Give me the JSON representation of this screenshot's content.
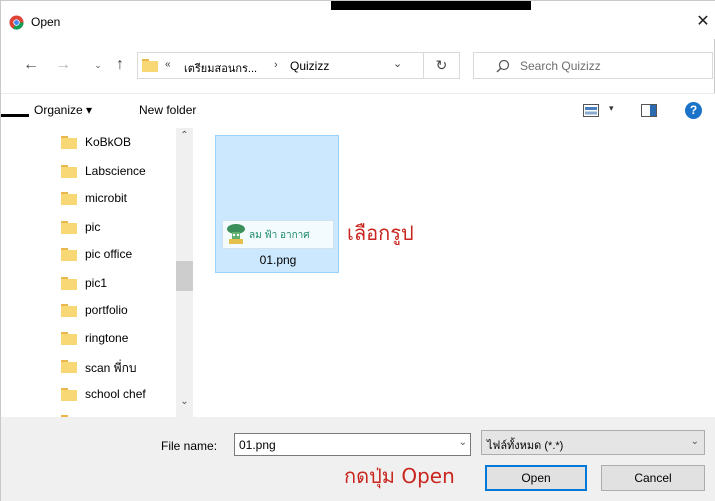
{
  "window": {
    "title": "Open",
    "close_glyph": "✕"
  },
  "nav": {
    "back_glyph": "←",
    "forward_glyph": "→",
    "recent_glyph": "⌄",
    "up_glyph": "↑",
    "address": {
      "chevron": "«",
      "segment1": "เตรียมสอนกร...",
      "separator": "›",
      "segment2": "Quizizz",
      "dropdown_glyph": "⌄"
    },
    "refresh_glyph": "↻",
    "search_placeholder": "Search Quizizz"
  },
  "toolbar": {
    "organize_label": "Organize ▾",
    "new_folder_label": "New folder",
    "view_dropdown_glyph": "▾",
    "help_glyph": "?"
  },
  "tree": {
    "scroll_up_glyph": "⌃",
    "scroll_down_glyph": "⌄",
    "items": [
      {
        "label": "KoBkOB"
      },
      {
        "label": "Labscience"
      },
      {
        "label": "microbit"
      },
      {
        "label": "pic"
      },
      {
        "label": "pic office"
      },
      {
        "label": "pic1"
      },
      {
        "label": "portfolio"
      },
      {
        "label": "ringtone"
      },
      {
        "label": "scan พี่กบ"
      },
      {
        "label": "school chef"
      }
    ]
  },
  "content": {
    "files": [
      {
        "name": "01.png",
        "thumb_text": "ลม ฟ้า อากาศ",
        "selected": true
      }
    ],
    "annotation_select": "เลือกรูป"
  },
  "bottom": {
    "file_name_label": "File name:",
    "file_name_value": "01.png",
    "file_name_dd": "⌄",
    "file_type_value": "ไฟล์ทั้งหมด (*.*)",
    "file_type_dd": "⌄",
    "annotation_open": "กดปุ่ม Open",
    "open_label": "Open",
    "cancel_label": "Cancel"
  },
  "colors": {
    "accent": "#0078d7",
    "annotation": "#c8261f",
    "selection_bg": "#cce8ff",
    "folder": "#f8d775"
  }
}
